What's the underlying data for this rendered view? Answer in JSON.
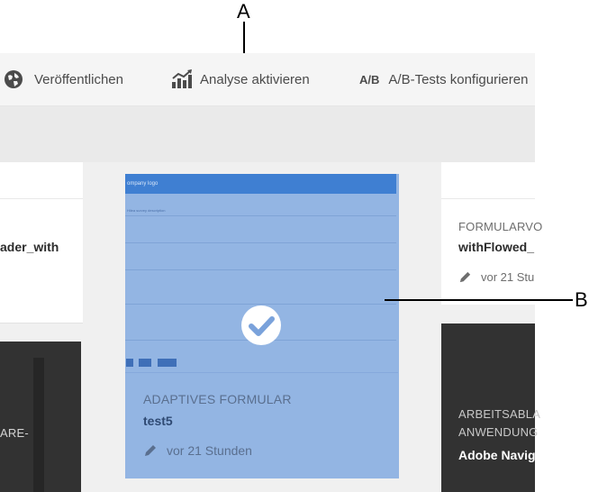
{
  "callouts": {
    "a": "A",
    "b": "B"
  },
  "toolbar": {
    "publish_label": "Veröffentlichen",
    "analytics_label": "Analyse aktivieren",
    "ab_icon_text": "A/B",
    "ab_label": "A/B-Tests konfigurieren"
  },
  "left_card": {
    "name_fragment": "ader_with"
  },
  "left_dark_card": {
    "type_fragment": "ARE-"
  },
  "selected_card": {
    "thumbnail_header": "ompany logo",
    "thumbnail_description": "Hilea survey description",
    "type": "ADAPTIVES FORMULAR",
    "name": "test5",
    "time": "vor 21 Stunden"
  },
  "right_card": {
    "type_fragment": "FORMULARVO",
    "name_fragment": "withFlowed_",
    "time_fragment": "vor 21 Stu"
  },
  "right_dark_card": {
    "type_line1": "ARBEITSABLA",
    "type_line2": "ANWENDUNG",
    "name_fragment": "Adobe Navig"
  },
  "colors": {
    "selection_overlay": "#93b5e3",
    "thumbnail_header": "#3f7fd2",
    "dark_card": "#323232"
  }
}
